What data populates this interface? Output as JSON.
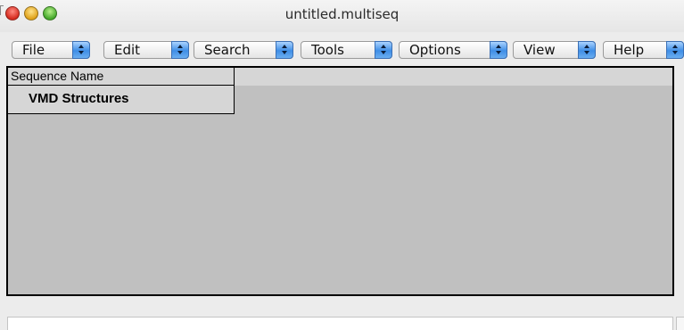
{
  "window": {
    "title": "untitled.multiseq"
  },
  "menubar": {
    "items": [
      {
        "label": "File"
      },
      {
        "label": "Edit"
      },
      {
        "label": "Search"
      },
      {
        "label": "Tools"
      },
      {
        "label": "Options"
      },
      {
        "label": "View"
      },
      {
        "label": "Help"
      }
    ]
  },
  "sequence_panel": {
    "header": "Sequence Name",
    "rows": [
      {
        "label": "VMD Structures"
      }
    ]
  },
  "status": {
    "value": ""
  },
  "colors": {
    "panel_background": "#c0c0c0",
    "header_background": "#d6d6d6",
    "popup_arrow": "#3f8ee6"
  },
  "icons": [
    "close-button-icon",
    "minimize-button-icon",
    "zoom-button-icon",
    "popup-arrows-icon"
  ]
}
